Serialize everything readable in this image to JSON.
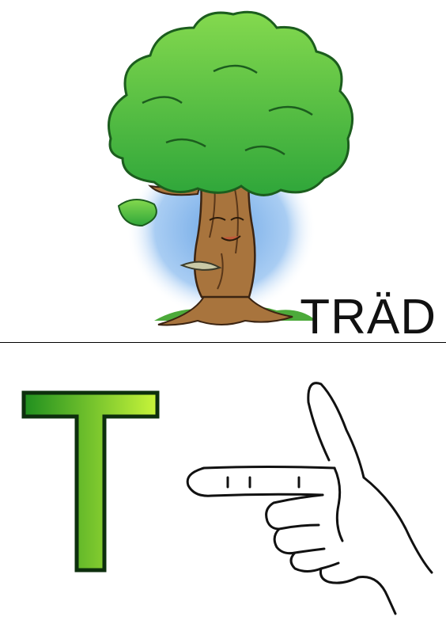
{
  "word": "TRÄD",
  "letter": "T",
  "icons": {
    "illustration": "tree-with-face-icon",
    "sign": "hand-sign-t-icon"
  },
  "colors": {
    "letter_gradient_start": "#1f8f1f",
    "letter_gradient_end": "#c8f53a",
    "foliage": "#3cb83a",
    "foliage_light": "#7fd34a",
    "trunk": "#a8743d",
    "sky": "#7fb0e8"
  }
}
